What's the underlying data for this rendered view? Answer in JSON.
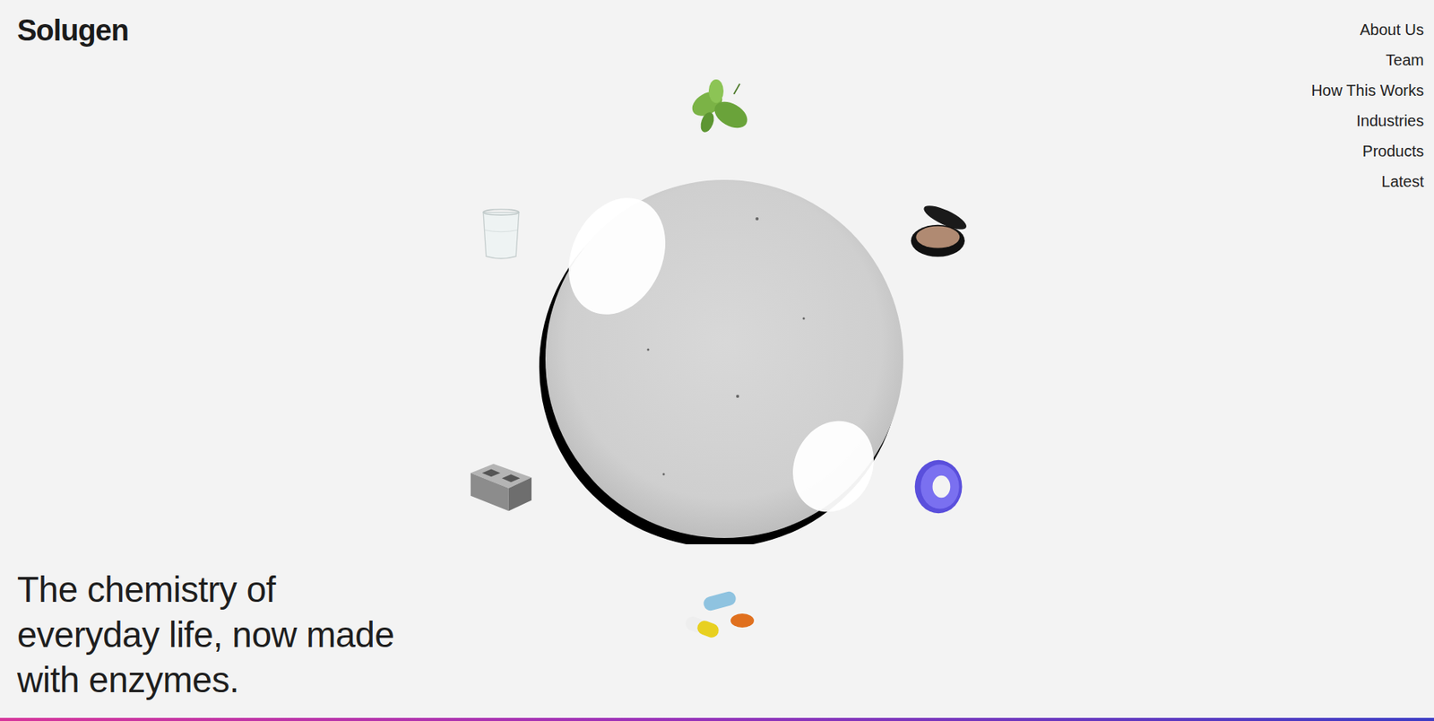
{
  "logo": "Solugen",
  "nav": {
    "items": [
      "About Us",
      "Team",
      "How This Works",
      "Industries",
      "Products",
      "Latest"
    ]
  },
  "hero": {
    "headline_lines": [
      "The chemistry of",
      "everyday life, now made",
      "with enzymes."
    ]
  }
}
